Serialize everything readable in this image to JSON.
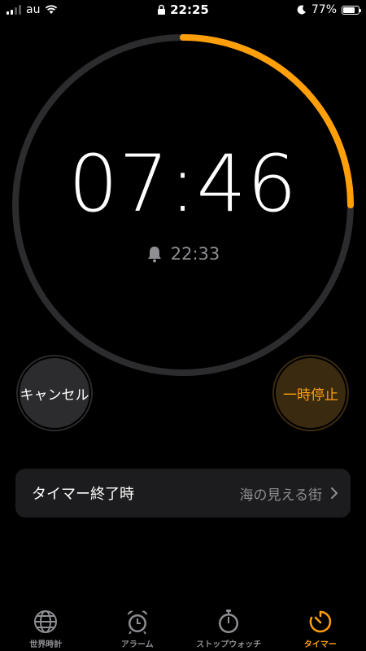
{
  "status_bar": {
    "carrier": "au",
    "time": "22:25",
    "battery": "77%",
    "battery_level": 0.77
  },
  "timer": {
    "remaining": "07:46",
    "end_time": "22:33",
    "progress_remaining": 0.25,
    "accent_color": "#ff9f0a",
    "track_color": "#2c2c2e"
  },
  "buttons": {
    "cancel": "キャンセル",
    "pause": "一時停止"
  },
  "end_action": {
    "label": "タイマー終了時",
    "value": "海の見える街"
  },
  "tabs": [
    {
      "label": "世界時計",
      "icon": "globe-icon"
    },
    {
      "label": "アラーム",
      "icon": "alarm-clock-icon"
    },
    {
      "label": "ストップウォッチ",
      "icon": "stopwatch-icon"
    },
    {
      "label": "タイマー",
      "icon": "timer-icon",
      "active": true
    }
  ]
}
